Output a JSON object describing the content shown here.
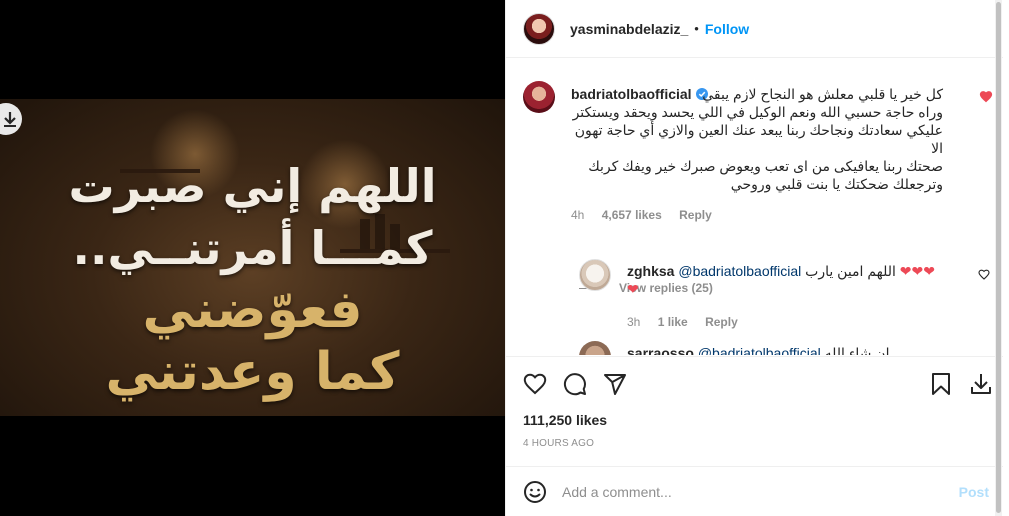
{
  "post": {
    "author": "yasminabdelaziz_",
    "dot": "•",
    "follow_label": "Follow",
    "image_text": {
      "line1": "اللهم إني صبرت",
      "line2": "كمـــا أمرتنــي..",
      "line3": "فعوّضني",
      "line4": "كما وعدتني"
    },
    "likes": "111,250 likes",
    "time": "4 HOURS AGO",
    "add_comment_placeholder": "Add a comment...",
    "post_label": "Post"
  },
  "comments": [
    {
      "user": "badriatolbaofficial",
      "verified": true,
      "text_lines": [
        "كل خير يا قلبي معلش هو النجاح لازم يبقي",
        "وراه حاجة حسبي الله ونعم الوكيل في اللي يحسد ويحقد ويستكتر",
        "عليكي سعادتك ونجاحك ربنا يبعد عنك العين والازي أي حاجة تهون الا",
        "صحتك ربنا يعافيكى من اى تعب ويعوض صبرك خير ويفك كربك",
        "وترجعلك ضحكتك يا بنت قلبي وروحي"
      ],
      "age": "4h",
      "likes": "4,657 likes",
      "reply": "Reply",
      "liked": true
    }
  ],
  "view_replies": "View replies (25)",
  "replies": [
    {
      "user": "zghksa",
      "mention": "@badriatolbaofficial",
      "text": "اللهم امين يارب",
      "hearts_line1": "❤❤❤",
      "hearts_line2": "❤",
      "age": "3h",
      "likes": "1 like",
      "reply": "Reply"
    },
    {
      "user": "sarraosso",
      "mention": "@badriatolbaofficial",
      "text": "ان شاء الله"
    }
  ],
  "colors": {
    "accent": "#0095f6",
    "like_red": "#ed4956",
    "gold_text": "#d7b36a"
  },
  "icons": [
    "download-icon",
    "verified-icon",
    "heart-icon",
    "comment-icon",
    "share-icon",
    "save-icon",
    "download-post-icon",
    "emoji-icon"
  ]
}
